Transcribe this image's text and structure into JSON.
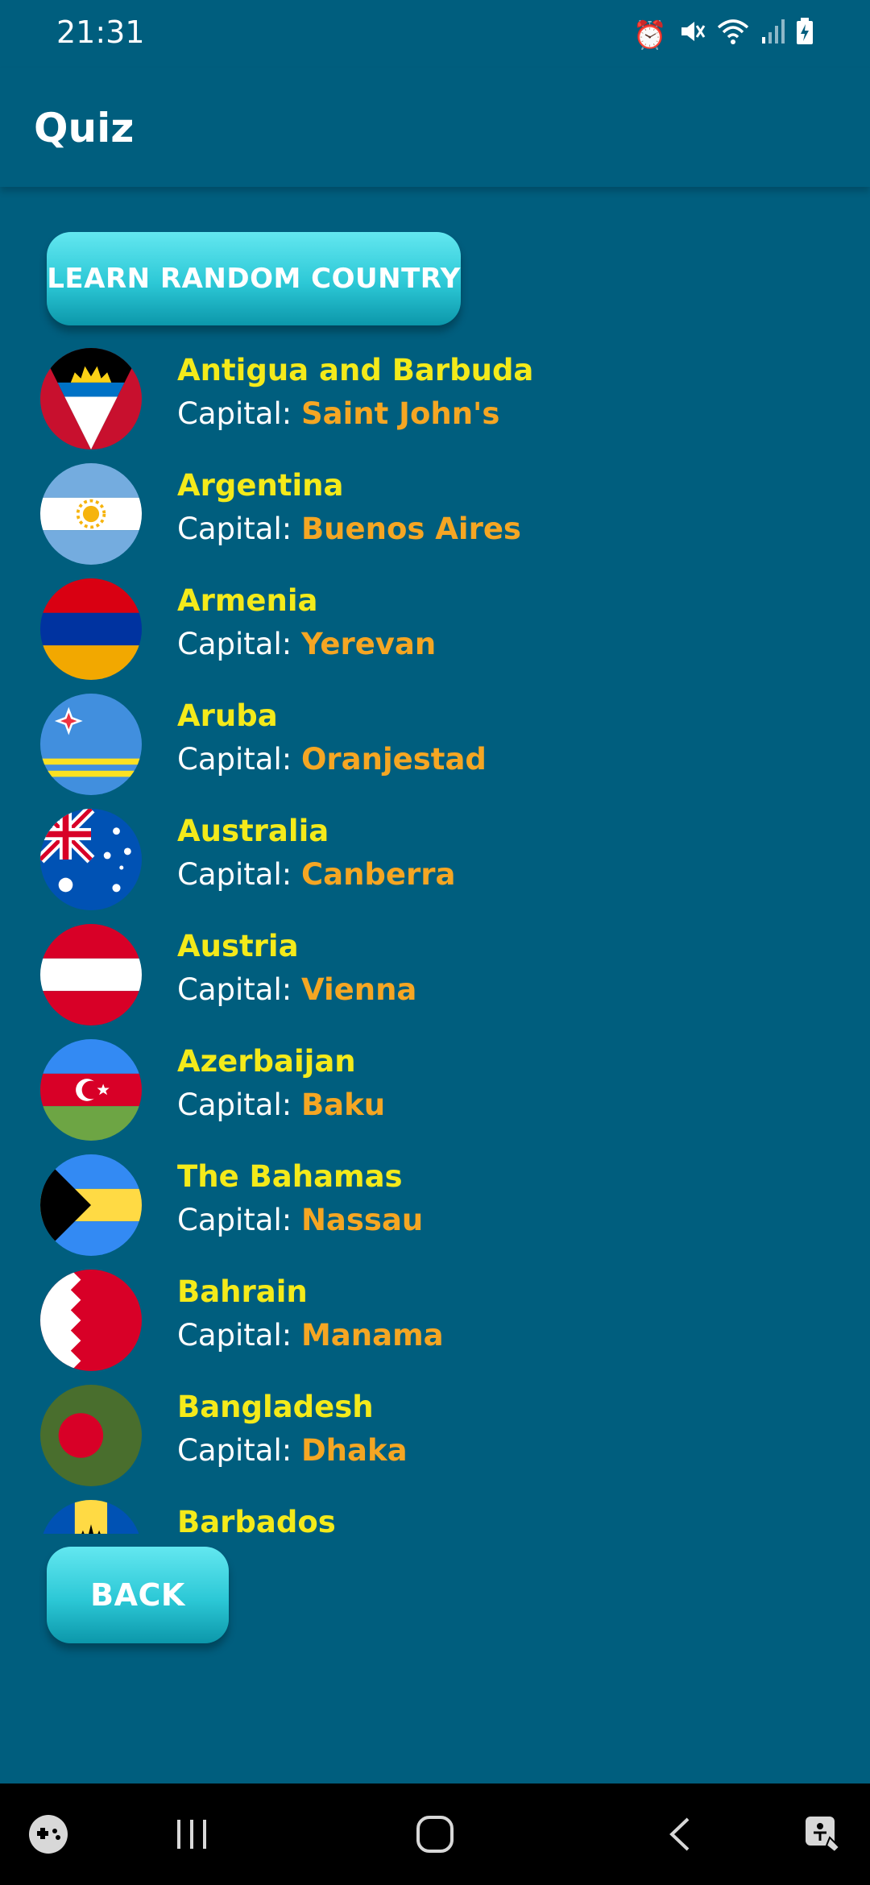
{
  "status_bar": {
    "time": "21:31"
  },
  "app_bar": {
    "title": "Quiz"
  },
  "buttons": {
    "learn_random": "LEARN RANDOM COUNTRY",
    "back": "BACK"
  },
  "capital_label": "Capital: ",
  "countries": [
    {
      "name": "Antigua and Barbuda",
      "capital": "Saint John's"
    },
    {
      "name": "Argentina",
      "capital": "Buenos Aires"
    },
    {
      "name": "Armenia",
      "capital": "Yerevan"
    },
    {
      "name": "Aruba",
      "capital": "Oranjestad"
    },
    {
      "name": "Australia",
      "capital": "Canberra"
    },
    {
      "name": "Austria",
      "capital": "Vienna"
    },
    {
      "name": "Azerbaijan",
      "capital": "Baku"
    },
    {
      "name": "The Bahamas",
      "capital": "Nassau"
    },
    {
      "name": "Bahrain",
      "capital": "Manama"
    },
    {
      "name": "Bangladesh",
      "capital": "Dhaka"
    },
    {
      "name": "Barbados",
      "capital": ""
    }
  ],
  "colors": {
    "background": "#005e7e",
    "country_name": "#f4ea1a",
    "capital_value": "#f5a623",
    "button_top": "#63e7f0",
    "button_bottom": "#0c97aa"
  },
  "icons": {
    "status": [
      "alarm-icon",
      "mute-icon",
      "wifi-icon",
      "signal-icon",
      "battery-icon"
    ],
    "nav": [
      "game-launcher-icon",
      "recents-icon",
      "home-icon",
      "back-icon",
      "accessibility-icon"
    ]
  }
}
